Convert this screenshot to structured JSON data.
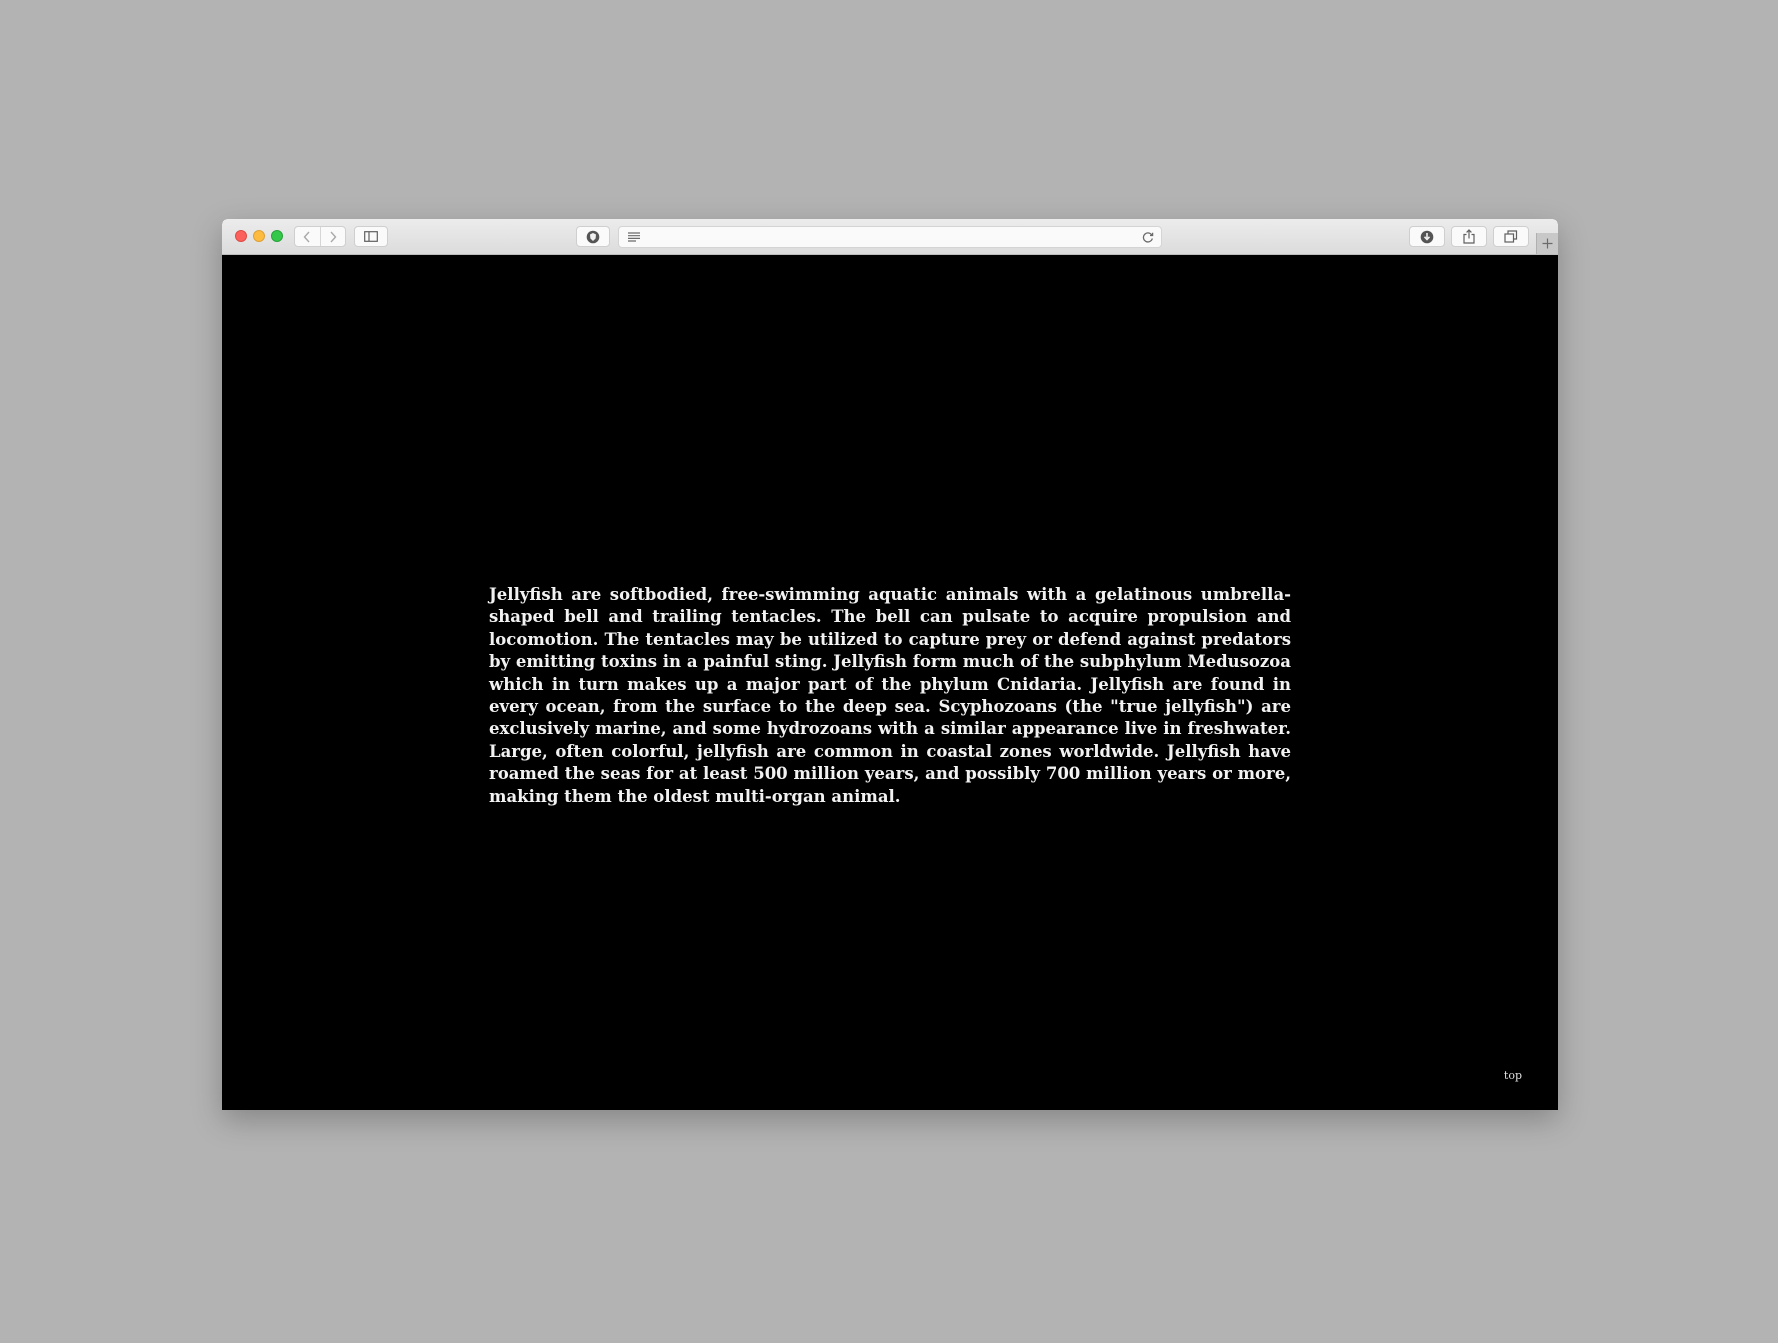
{
  "browser": {
    "address": "",
    "buttons": {
      "back": "back-icon",
      "forward": "forward-icon",
      "sidebar": "sidebar-icon",
      "privacy": "privacy-icon",
      "reader": "reader-icon",
      "reload": "reload-icon",
      "downloads": "download-icon",
      "share": "share-icon",
      "tabs": "tabs-icon",
      "new_tab": "plus-icon"
    }
  },
  "page": {
    "paragraph": "Jellyfish are softbodied, free-swimming aquatic animals with a gelatinous umbrella-shaped bell and trailing tentacles. The bell can pulsate to acquire propulsion and locomotion. The tentacles may be utilized to capture prey or defend against predators by emitting toxins in a painful sting. Jellyfish form much of the subphylum Medusozoa which in turn makes up a major part of the phylum Cnidaria. Jellyfish are found in every ocean, from the surface to the deep sea. Scyphozoans (the \"true jellyfish\") are exclusively marine, and some hydrozoans with a similar appearance live in freshwater. Large, often colorful, jellyfish are common in coastal zones worldwide. Jellyfish have roamed the seas for at least 500 million years, and possibly 700 million years or more, making them the oldest multi-organ animal.",
    "top_link": "top"
  },
  "colors": {
    "desktop": "#b3b3b3",
    "page_background": "#000000",
    "text": "#f2f2f2"
  }
}
